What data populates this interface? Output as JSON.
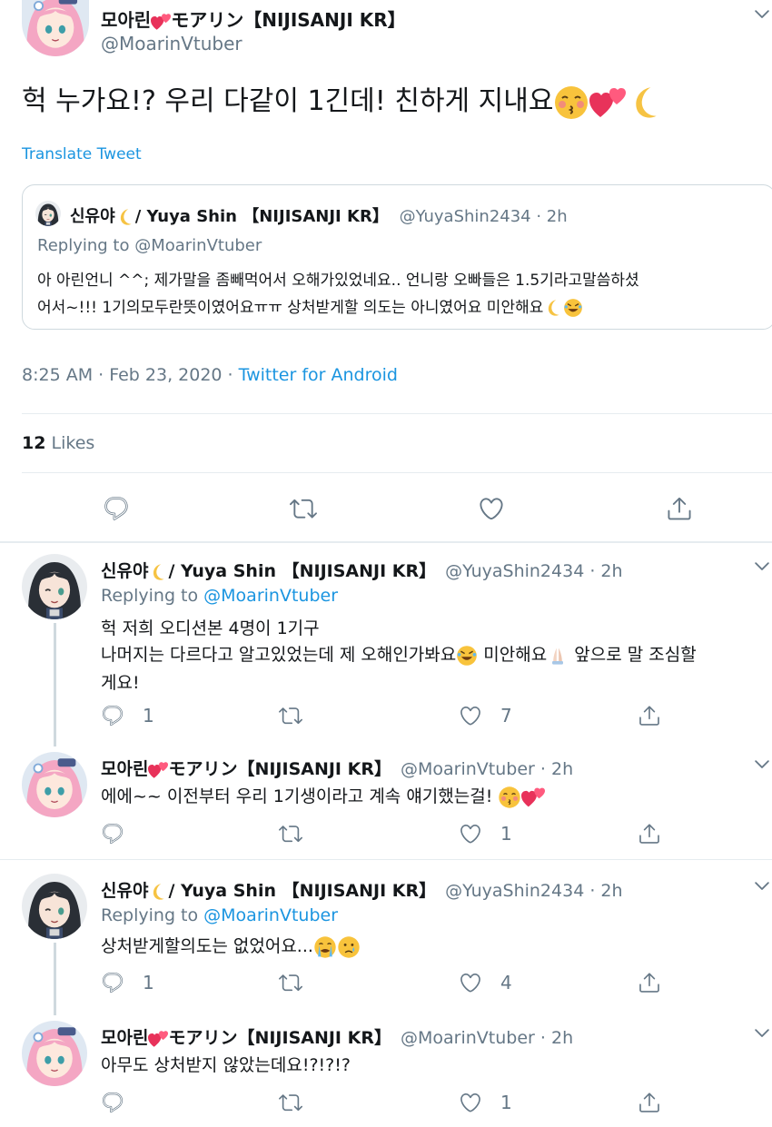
{
  "main_tweet": {
    "display_name": "모아린",
    "display_name_suffix": "モアリン【NIJISANJI KR】",
    "handle": "@MoarinVtuber",
    "text": "헉 누가요!? 우리 다같이 1긴데! 친하게 지내요",
    "translate": "Translate Tweet",
    "timestamp": "8:25 AM · Feb 23, 2020 · ",
    "source": "Twitter for Android",
    "likes_count": "12",
    "likes_label": "Likes"
  },
  "quoted_tweet": {
    "display_name": "신유야",
    "display_name_suffix": "/ Yuya Shin 【NIJISANJI KR】",
    "handle_time": "@YuyaShin2434 · 2h",
    "replying": "Replying to @MoarinVtuber",
    "text_line1": "아 아린언니 ^^; 제가말을 좀빼먹어서 오해가있었네요.. 언니랑 오빠들은 1.5기라고말씀하셨",
    "text_line2": "어서~!!! 1기의모두란뜻이였어요ㅠㅠ 상처받게할 의도는 아니였어요 미안해요"
  },
  "replies": [
    {
      "display_name": "신유야",
      "display_name_suffix": "/ Yuya Shin 【NIJISANJI KR】",
      "handle_time": "@YuyaShin2434 · 2h",
      "replying_prefix": "Replying to ",
      "replying_handle": "@MoarinVtuber",
      "line1": "헉 저희 오디션본 4명이 1기구",
      "line2a": "나머지는 다르다고 알고있었는데 제 오해인가봐요",
      "line2b": "미안해요",
      "line2c": "앞으로 말 조심할",
      "line3": "게요!",
      "reply_count": "1",
      "like_count": "7"
    },
    {
      "display_name": "모아린",
      "display_name_suffix": "モアリン【NIJISANJI KR】",
      "handle_time": "@MoarinVtuber · 2h",
      "line1": "에에~~ 이전부터 우리 1기생이라고 계속 얘기했는걸!",
      "like_count": "1"
    },
    {
      "display_name": "신유야",
      "display_name_suffix": "/ Yuya Shin 【NIJISANJI KR】",
      "handle_time": "@YuyaShin2434 · 2h",
      "replying_prefix": "Replying to ",
      "replying_handle": "@MoarinVtuber",
      "line1": "상처받게할의도는 없었어요...",
      "reply_count": "1",
      "like_count": "4"
    },
    {
      "display_name": "모아린",
      "display_name_suffix": "モアリン【NIJISANJI KR】",
      "handle_time": "@MoarinVtuber · 2h",
      "line1": "아무도 상처받지 않았는데요!?!?!?",
      "like_count": "1"
    }
  ],
  "icons": {
    "reply": "reply-icon",
    "retweet": "retweet-icon",
    "like": "heart-icon",
    "share": "share-icon",
    "caret": "chevron-down-icon"
  },
  "colors": {
    "link": "#1b95e0",
    "muted": "#657786",
    "divider": "#e6ecf0"
  }
}
